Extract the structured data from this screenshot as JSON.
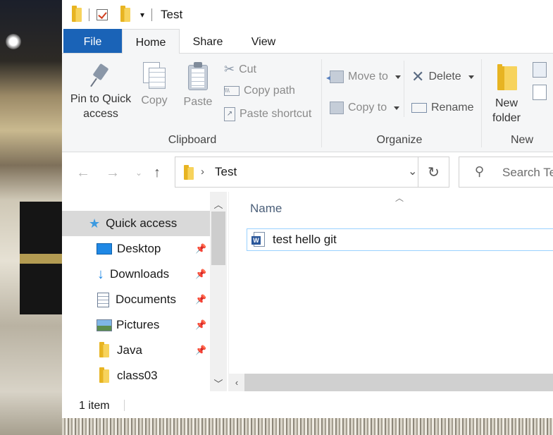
{
  "window": {
    "title": "Test"
  },
  "ribbon_tabs": [
    "File",
    "Home",
    "Share",
    "View"
  ],
  "clipboard": {
    "pin_label_1": "Pin to Quick",
    "pin_label_2": "access",
    "copy": "Copy",
    "paste": "Paste",
    "cut": "Cut",
    "copy_path": "Copy path",
    "paste_shortcut": "Paste shortcut",
    "group": "Clipboard"
  },
  "organize": {
    "move_to": "Move to",
    "copy_to": "Copy to",
    "delete": "Delete",
    "rename": "Rename",
    "group": "Organize"
  },
  "new": {
    "new_folder_1": "New",
    "new_folder_2": "folder",
    "group": "New"
  },
  "address": {
    "path": "Test",
    "search_placeholder": "Search Te"
  },
  "nav": [
    {
      "label": "Quick access",
      "icon": "star-icon",
      "pinned": false
    },
    {
      "label": "Desktop",
      "icon": "desktop-icon",
      "pinned": true
    },
    {
      "label": "Downloads",
      "icon": "download-icon",
      "pinned": true
    },
    {
      "label": "Documents",
      "icon": "documents-icon",
      "pinned": true
    },
    {
      "label": "Pictures",
      "icon": "pictures-icon",
      "pinned": true
    },
    {
      "label": "Java",
      "icon": "folder-icon",
      "pinned": true
    },
    {
      "label": "class03",
      "icon": "folder-icon",
      "pinned": false
    }
  ],
  "content": {
    "column_name": "Name",
    "files": [
      {
        "name": "test hello git",
        "icon": "word-document-icon"
      }
    ]
  },
  "status": {
    "count": "1 item"
  },
  "colors": {
    "accent": "#1a63b7",
    "selection_border": "#99d1ff",
    "folder": "#f3c23a"
  }
}
